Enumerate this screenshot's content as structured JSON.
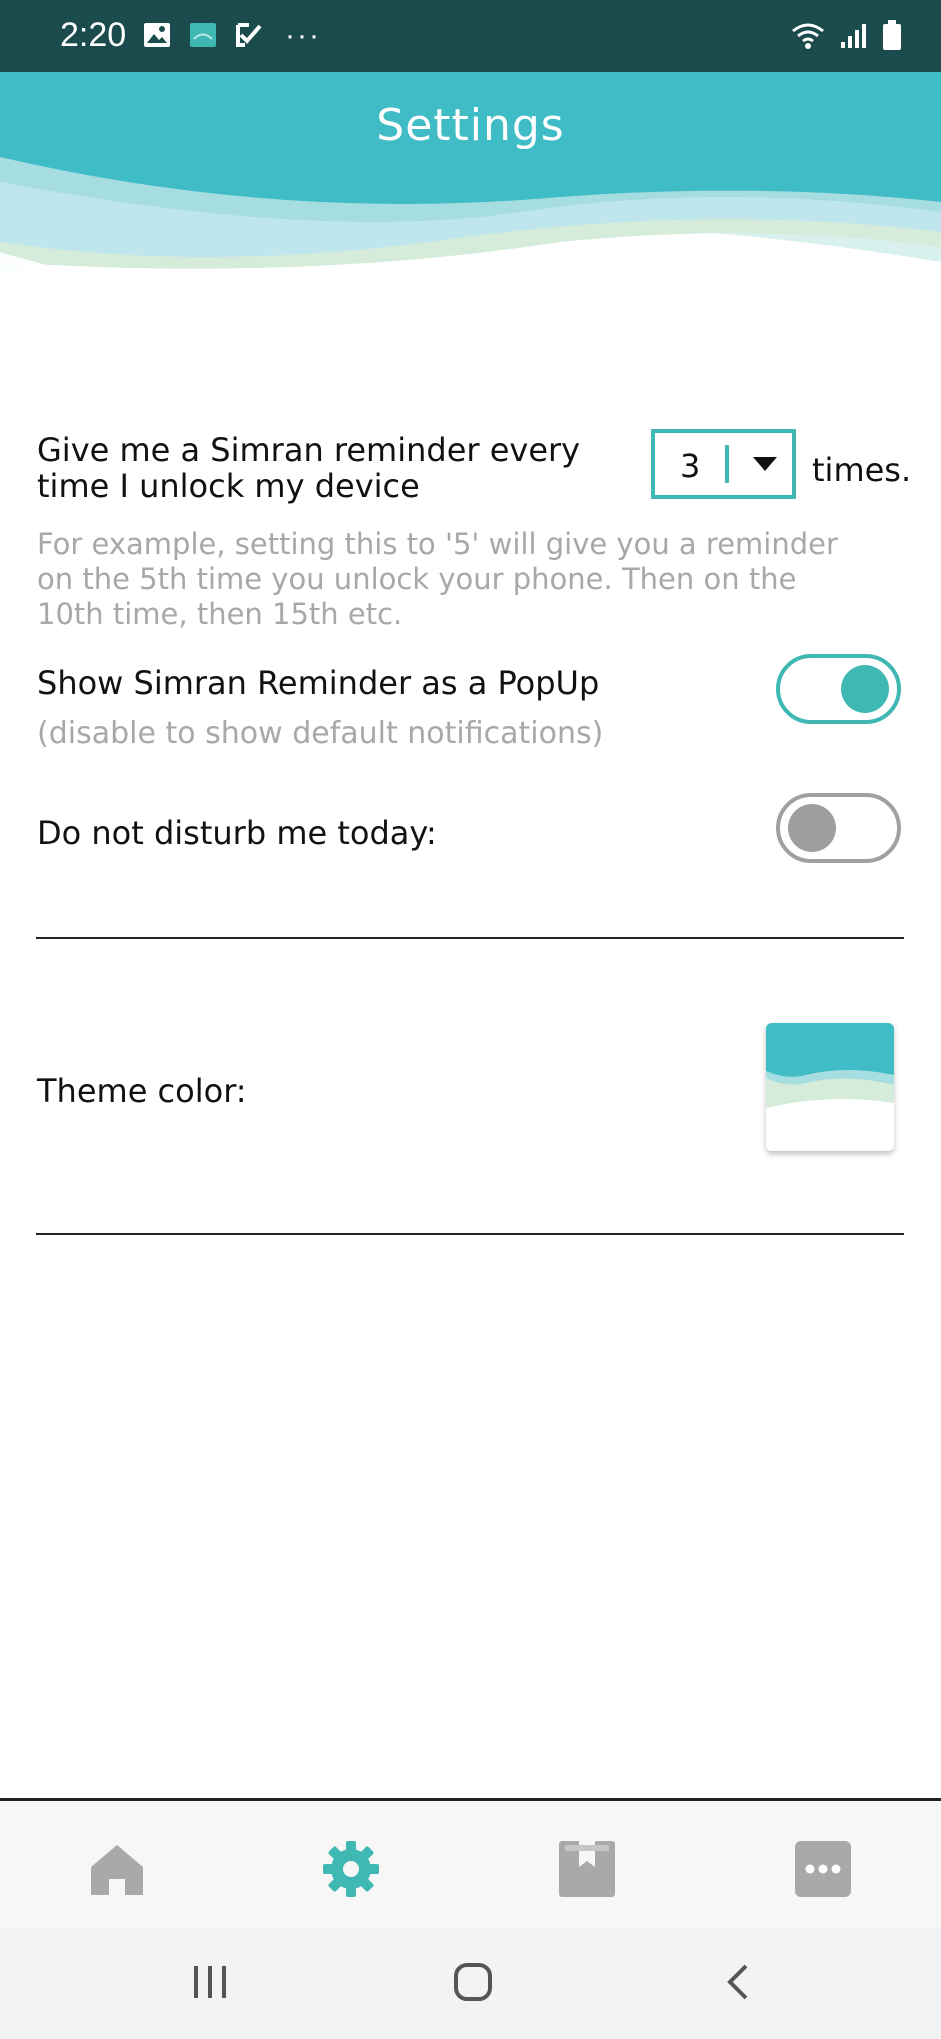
{
  "status_bar": {
    "time": "2:20",
    "left_icons": [
      "image-icon",
      "app-icon",
      "check-icon",
      "more-dots-icon"
    ],
    "right_icons": [
      "wifi-icon",
      "signal-icon",
      "battery-icon"
    ]
  },
  "header": {
    "title": "Settings"
  },
  "settings": {
    "reminder_label_line1": "Give me a Simran reminder every",
    "reminder_label_line2": "time I unlock my device",
    "reminder_count": "3",
    "times_label": "times.",
    "reminder_hint_line1": "For example, setting this to '5' will give you a reminder",
    "reminder_hint_line2": "on the 5th time you unlock your phone. Then on the",
    "reminder_hint_line3": "10th time, then 15th etc.",
    "popup_label": "Show Simran Reminder as a PopUp",
    "popup_hint": "(disable to show default notifications)",
    "popup_enabled": true,
    "dnd_label": "Do not disturb me today:",
    "dnd_enabled": false,
    "theme_label": "Theme color:"
  },
  "colors": {
    "accent": "#3fb8b4",
    "status_bar": "#1b4b4c",
    "hint_text": "#a8a8a8"
  },
  "bottom_nav": {
    "items": [
      "home-icon",
      "settings-gear-icon",
      "bookmark-book-icon",
      "more-icon"
    ],
    "active": "settings-gear-icon"
  },
  "system_nav": [
    "recents-icon",
    "home-circle-icon",
    "back-icon"
  ]
}
